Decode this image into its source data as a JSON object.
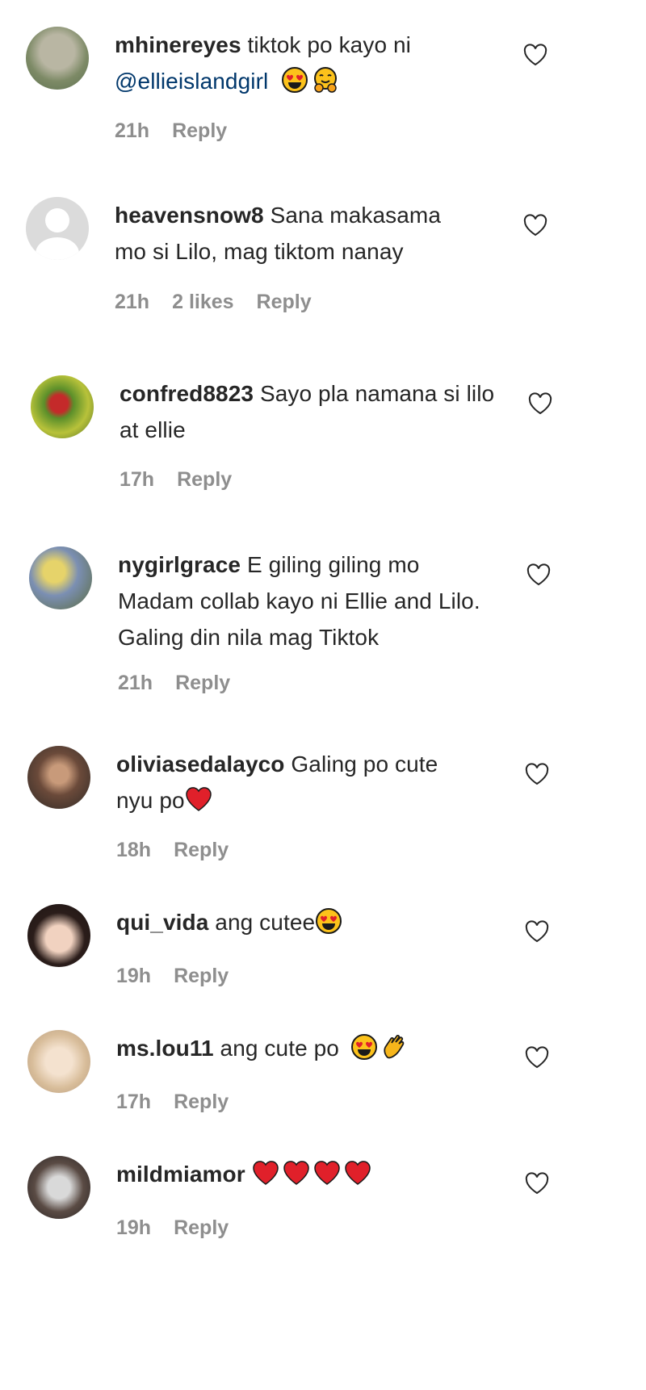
{
  "comments": [
    {
      "user": "mhinereyes",
      "text": " tiktok po kayo ni",
      "mention": "@ellieislandgirl",
      "time": "21h",
      "likes": "",
      "reply": "Reply",
      "emojis": [
        "heart-eyes-emoji",
        "hugging-emoji"
      ]
    },
    {
      "user": "heavensnow8",
      "text": " Sana makasama mo si Lilo, mag tiktom nanay",
      "time": "21h",
      "likes": "2 likes",
      "reply": "Reply"
    },
    {
      "user": "confred8823",
      "text": " Sayo pla namana si lilo at ellie",
      "time": "17h",
      "likes": "",
      "reply": "Reply"
    },
    {
      "user": "nygirlgrace",
      "text": " E giling giling mo Madam collab kayo ni Ellie and Lilo. Galing din nila mag Tiktok",
      "time": "21h",
      "likes": "",
      "reply": "Reply"
    },
    {
      "user": "oliviasedalayco",
      "text": " Galing po cute nyu po",
      "time": "18h",
      "likes": "",
      "reply": "Reply",
      "emojis": [
        "red-heart-emoji"
      ]
    },
    {
      "user": "qui_vida",
      "text": " ang cutee",
      "time": "19h",
      "likes": "",
      "reply": "Reply",
      "emojis": [
        "heart-eyes-emoji"
      ]
    },
    {
      "user": "ms.lou11",
      "text": " ang cute po ",
      "time": "17h",
      "likes": "",
      "reply": "Reply",
      "emojis": [
        "heart-eyes-emoji",
        "clapping-hands-emoji"
      ]
    },
    {
      "user": "mildmiamor",
      "text": " ",
      "time": "19h",
      "likes": "",
      "reply": "Reply",
      "emojis": [
        "red-heart-emoji",
        "red-heart-emoji",
        "red-heart-emoji",
        "red-heart-emoji"
      ]
    }
  ],
  "colors": {
    "text": "#262626",
    "meta": "#8e8e8e",
    "mention": "#00376b"
  }
}
